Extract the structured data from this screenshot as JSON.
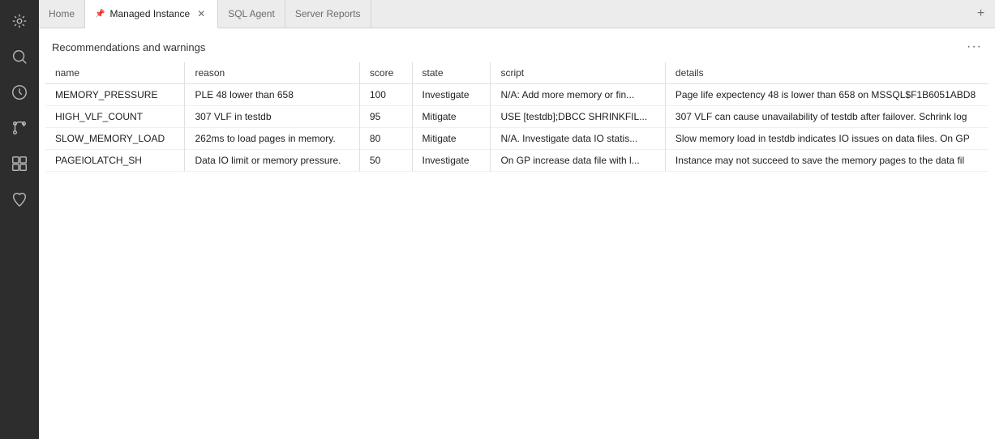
{
  "activityBar": {
    "items": [
      {
        "name": "connections-icon",
        "label": "Connections"
      },
      {
        "name": "search-icon",
        "label": "Search"
      },
      {
        "name": "insights-icon",
        "label": "Insights"
      },
      {
        "name": "git-icon",
        "label": "Source Control"
      },
      {
        "name": "extensions-icon",
        "label": "Extensions"
      },
      {
        "name": "health-icon",
        "label": "Health"
      }
    ]
  },
  "tabs": [
    {
      "id": "home",
      "label": "Home",
      "active": false,
      "pinned": false,
      "closeable": false
    },
    {
      "id": "managed-instance",
      "label": "Managed Instance",
      "active": true,
      "pinned": true,
      "closeable": true
    },
    {
      "id": "sql-agent",
      "label": "SQL Agent",
      "active": false,
      "pinned": false,
      "closeable": false
    },
    {
      "id": "server-reports",
      "label": "Server Reports",
      "active": false,
      "pinned": false,
      "closeable": false
    }
  ],
  "addTab": "+",
  "section": {
    "title": "Recommendations and warnings",
    "menuLabel": "···"
  },
  "table": {
    "columns": [
      "name",
      "reason",
      "score",
      "state",
      "script",
      "details"
    ],
    "rows": [
      {
        "name": "MEMORY_PRESSURE",
        "reason": "PLE 48 lower than 658",
        "score": "100",
        "state": "Investigate",
        "script": "N/A: Add more memory or fin...",
        "details": "Page life expectency 48 is lower than 658 on MSSQL$F1B6051ABD8"
      },
      {
        "name": "HIGH_VLF_COUNT",
        "reason": "307 VLF in testdb",
        "score": "95",
        "state": "Mitigate",
        "script": "USE [testdb];DBCC SHRINKFIL...",
        "details": "307 VLF can cause unavailability of testdb after failover. Schrink log"
      },
      {
        "name": "SLOW_MEMORY_LOAD",
        "reason": "262ms to load pages in memory.",
        "score": "80",
        "state": "Mitigate",
        "script": "N/A. Investigate data IO statis...",
        "details": "Slow memory load in testdb indicates IO issues on data files. On GP"
      },
      {
        "name": "PAGEIOLATCH_SH",
        "reason": "Data IO limit or memory pressure.",
        "score": "50",
        "state": "Investigate",
        "script": "On GP increase data file with l...",
        "details": "Instance may not succeed to save the memory pages to the data fil"
      }
    ]
  }
}
